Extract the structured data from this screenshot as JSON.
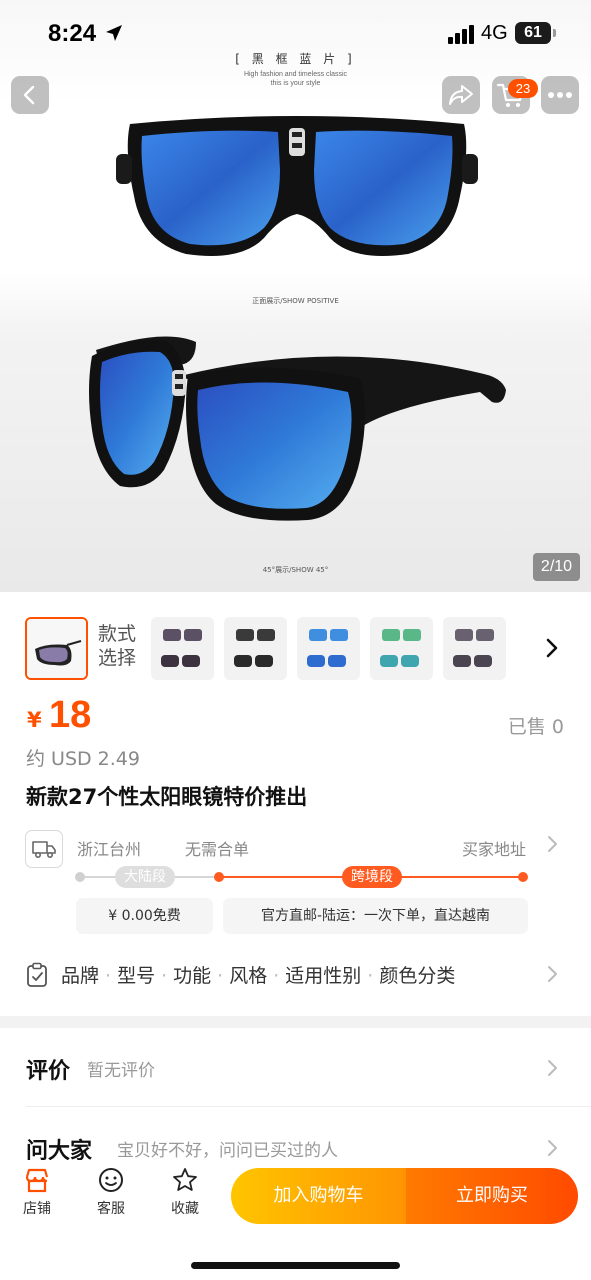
{
  "status_bar": {
    "time": "8:24",
    "network": "4G",
    "battery": "61"
  },
  "nav": {
    "cart_badge": "23"
  },
  "gallery": {
    "banner_title": "[ 黑 框 蓝 片 ]",
    "banner_sub_1": "High fashion and timeless classic",
    "banner_sub_2": "this is your style",
    "caption_front": "正面展示/SHOW POSITIVE",
    "caption_angle": "45°展示/SHOW 45°",
    "page_indicator": "2/10",
    "lens_color": "#2d6fd6"
  },
  "variants": {
    "label": "款式选择",
    "thumbnails": [
      "purple-gradient",
      "black-gray",
      "blue-mirror",
      "green-mirror",
      "gray-gradient"
    ]
  },
  "price": {
    "currency": "¥",
    "value": "18",
    "sold": "已售 0",
    "usd": "约 USD 2.49"
  },
  "product_title": "新款27个性太阳眼镜特价推出",
  "shipping": {
    "origin": "浙江台州",
    "merge": "无需合单",
    "destination": "买家地址",
    "segment_1": "大陆段",
    "segment_2": "跨境段",
    "fee_1": "¥ 0.00免费",
    "fee_2": "官方直邮-陆运：一次下单，直达越南"
  },
  "params": [
    "品牌",
    "型号",
    "功能",
    "风格",
    "适用性别",
    "颜色分类"
  ],
  "reviews": {
    "label": "评价",
    "empty_text": "暂无评价"
  },
  "qa": {
    "label": "问大家",
    "hint": "宝贝好不好，问问已买过的人"
  },
  "bottom_bar": {
    "shop": "店铺",
    "service": "客服",
    "favorite": "收藏",
    "add_to_cart": "加入购物车",
    "buy_now": "立即购买"
  },
  "colors": {
    "accent": "#ff5000",
    "cart_button": "#ffa000",
    "buy_button": "#ff5a00"
  }
}
